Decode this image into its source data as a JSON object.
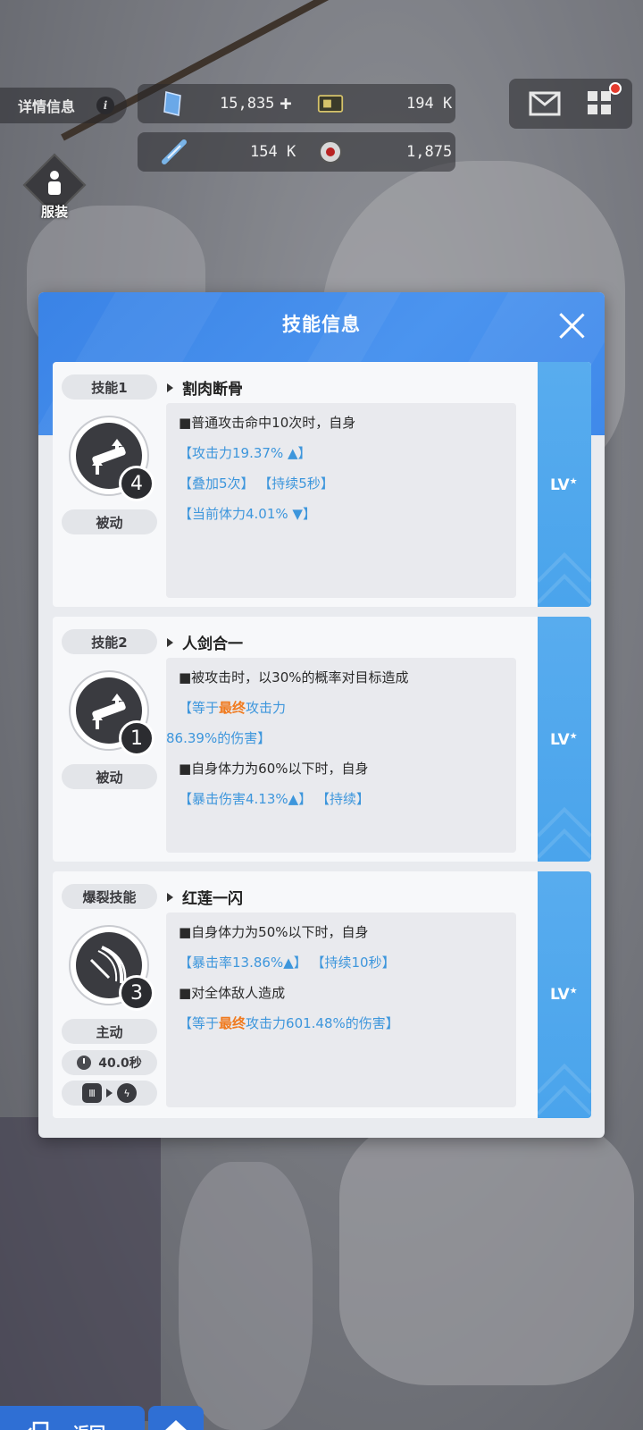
{
  "hud": {
    "detail_label": "详情信息",
    "info_glyph": "i",
    "resources": [
      {
        "name": "crystal-icon",
        "value": "15,835",
        "plus": "+"
      },
      {
        "name": "card-icon",
        "value": "194 K"
      },
      {
        "name": "syringe-icon",
        "value": "154 K"
      },
      {
        "name": "orb-icon",
        "value": "1,875"
      }
    ],
    "outfit_label": "服装"
  },
  "modal": {
    "title": "技能信息",
    "lv_label": "LV",
    "lv_sup": "★",
    "skills": [
      {
        "tag": "技能1",
        "name": "割肉断骨",
        "level": "4",
        "type": "被动",
        "lines": [
          {
            "text": "■普通攻击命中10次时，自身"
          },
          {
            "text": "【攻击力19.37% ▲】"
          },
          {
            "text": "【叠加5次】 【持续5秒】"
          },
          {
            "text": "【当前体力4.01% ▼】"
          }
        ]
      },
      {
        "tag": "技能2",
        "name": "人剑合一",
        "level": "1",
        "type": "被动",
        "lines": [
          {
            "text": "■被攻击时，以30%的概率对目标造成"
          },
          {
            "prefix": "【等于",
            "highlight": "最终",
            "suffix": "攻击力"
          },
          {
            "text": "86.39%的伤害】"
          },
          {
            "text": "■自身体力为60%以下时，自身"
          },
          {
            "text": "【暴击伤害4.13%▲】 【持续】"
          }
        ]
      },
      {
        "tag": "爆裂技能",
        "name": "红莲一闪",
        "level": "3",
        "type": "主动",
        "cooldown": "40.0秒",
        "burst_from": "Ⅲ",
        "burst_to": "ϟ",
        "lines": [
          {
            "text": "■自身体力为50%以下时，自身"
          },
          {
            "text": "【暴击率13.86%▲】 【持续10秒】"
          },
          {
            "text": "■对全体敌人造成"
          },
          {
            "prefix": "【等于",
            "highlight": "最终",
            "suffix": "攻击力601.48%的伤害】"
          }
        ]
      }
    ]
  },
  "nav": {
    "back_label": "返回"
  },
  "colors": {
    "header_blue": "#3a83e6",
    "lv_blue": "#4aa4ec",
    "desc_blue": "#3d96dc",
    "highlight_orange": "#f07a1e"
  }
}
